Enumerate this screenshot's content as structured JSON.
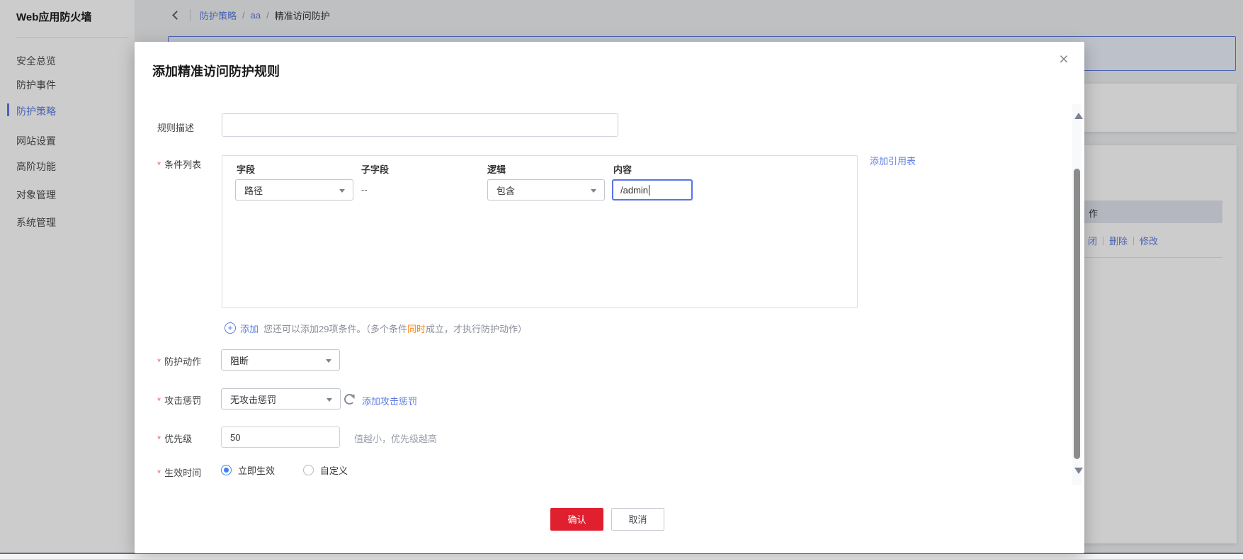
{
  "sidebar": {
    "title": "Web应用防火墙",
    "items": [
      {
        "label": "安全总览",
        "active": false
      },
      {
        "label": "防护事件",
        "active": false
      },
      {
        "label": "防护策略",
        "active": true
      },
      {
        "label": "网站设置",
        "active": false
      },
      {
        "label": "高阶功能",
        "active": false
      },
      {
        "label": "对象管理",
        "active": false
      },
      {
        "label": "系统管理",
        "active": false
      }
    ]
  },
  "breadcrumb": {
    "links": [
      "防护策略",
      "aa"
    ],
    "separator": "/",
    "current": "精准访问防护"
  },
  "background": {
    "table_header_partial": "作",
    "actions": [
      "闭",
      "删除",
      "修改"
    ]
  },
  "modal": {
    "title": "添加精准访问防护规则",
    "close_glyph": "×",
    "required_mark": "*",
    "form": {
      "rule_desc": {
        "label": "规则描述",
        "value": ""
      },
      "conditions": {
        "label": "条件列表",
        "columns": [
          "字段",
          "子字段",
          "逻辑",
          "内容"
        ],
        "row": {
          "field": "路径",
          "subfield": "--",
          "logic": "包含",
          "content": "/admin"
        },
        "add_glyph": "+",
        "add_label": "添加",
        "hint_pre": "您还可以添加29项条件。（多个条件",
        "hint_highlight": "同时",
        "hint_post": "成立，才执行防护动作）",
        "ref_link": "添加引用表"
      },
      "action": {
        "label": "防护动作",
        "value": "阻断"
      },
      "penalty": {
        "label": "攻击惩罚",
        "value": "无攻击惩罚",
        "add_link": "添加攻击惩罚"
      },
      "priority": {
        "label": "优先级",
        "value": "50",
        "hint": "值越小，优先级越高"
      },
      "effective": {
        "label": "生效时间",
        "options": [
          "立即生效",
          "自定义"
        ],
        "selected_index": 0
      }
    },
    "footer": {
      "confirm": "确认",
      "cancel": "取消"
    }
  },
  "colors": {
    "accent_blue": "#5e7ce0",
    "radio_blue": "#3d7ff3",
    "danger_red": "#e0202e",
    "highlight_orange": "#fa8616"
  }
}
